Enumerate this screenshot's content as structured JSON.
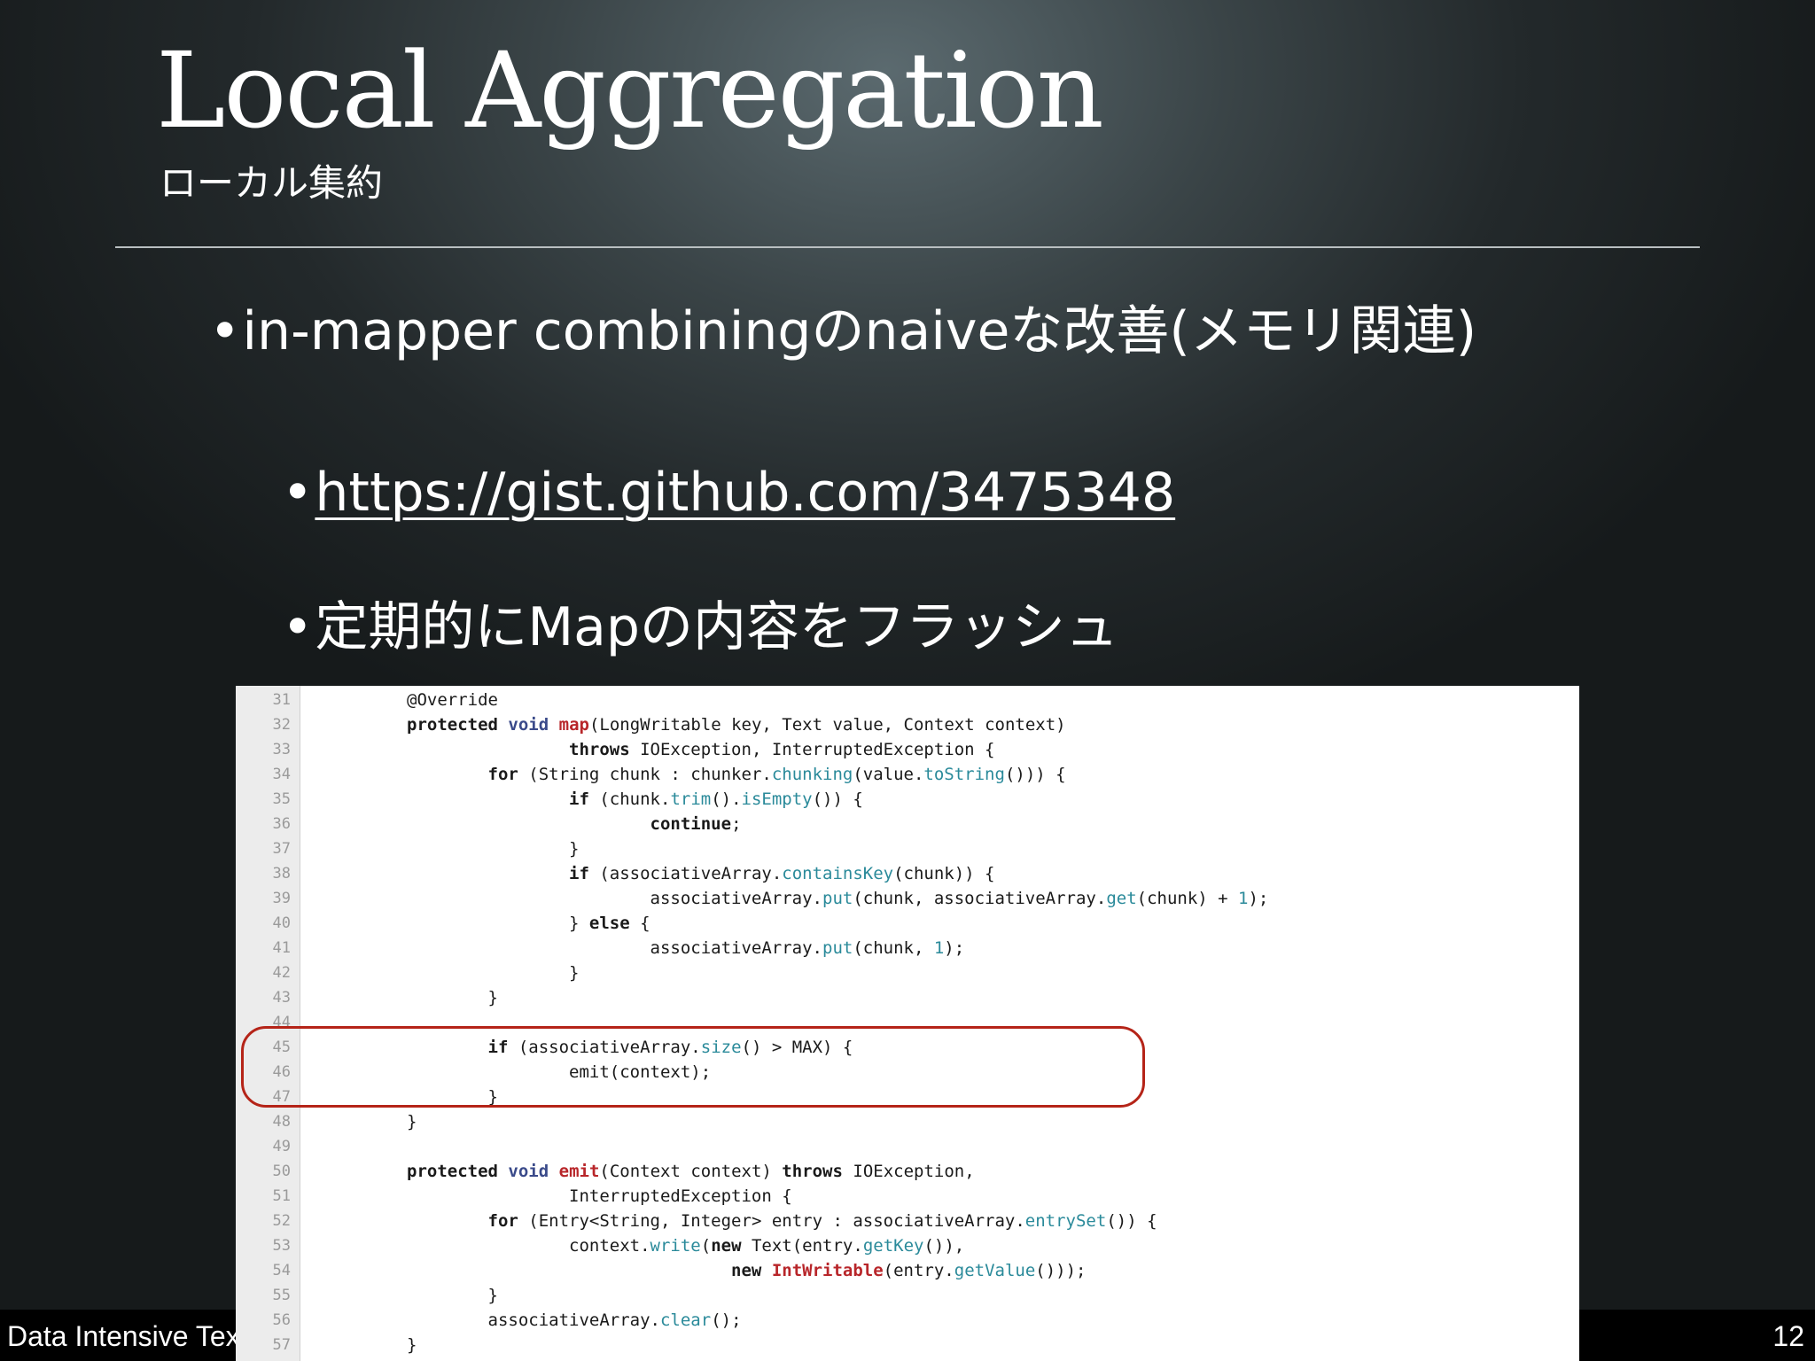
{
  "slide": {
    "title": "Local Aggregation",
    "subtitle": "ローカル集約",
    "bullets": [
      "in-mapper combiningのnaiveな改善(メモリ関連)",
      "https://gist.github.com/3475348",
      "定期的にMapの内容をフラッシュ"
    ],
    "bullet_symbol": "•",
    "footer": "Data Intensive Text Processing with MapReduce",
    "page_number": "12",
    "highlight_color": "#b52418"
  },
  "code": {
    "line_numbers": [
      "31",
      "32",
      "33",
      "34",
      "35",
      "36",
      "37",
      "38",
      "39",
      "40",
      "41",
      "42",
      "43",
      "44",
      "45",
      "46",
      "47",
      "48",
      "49",
      "50",
      "51",
      "52",
      "53",
      "54",
      "55",
      "56",
      "57"
    ]
  }
}
